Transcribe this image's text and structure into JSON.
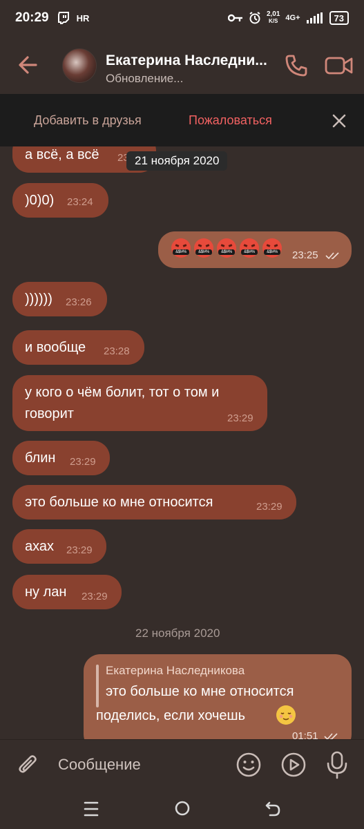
{
  "status_bar": {
    "time": "20:29",
    "carrier_badge": "HR",
    "speed_value": "2,01",
    "speed_unit": "K/S",
    "network": "4G+",
    "battery": "73"
  },
  "header": {
    "contact_name": "Екатерина Наследни...",
    "status": "Обновление..."
  },
  "actions": {
    "add_friend": "Добавить в друзья",
    "report": "Пожаловаться"
  },
  "messages": [
    {
      "dir": "in",
      "text": "а всё, а всё",
      "time": "23"
    },
    {
      "dir": "in",
      "text": ")0)0)",
      "time": "23:24"
    },
    {
      "dir": "out",
      "emoji_text": "&$!#%",
      "time": "23:25"
    },
    {
      "dir": "in",
      "text": "))))))",
      "time": "23:26"
    },
    {
      "dir": "in",
      "text": "и вообще",
      "time": "23:28"
    },
    {
      "dir": "in",
      "text_line1": "у кого о чём болит, тот о том и",
      "text_line2": "говорит",
      "time": "23:29"
    },
    {
      "dir": "in",
      "text": "блин",
      "time": "23:29"
    },
    {
      "dir": "in",
      "text": "это больше ко мне относится",
      "time": "23:29"
    },
    {
      "dir": "in",
      "text": "ахах",
      "time": "23:29"
    },
    {
      "dir": "in",
      "text": "ну лан",
      "time": "23:29"
    },
    {
      "dir": "out",
      "reply_name": "Екатерина Наследникова",
      "reply_text": "это больше ко мне относится",
      "text": "поделись, если хочешь",
      "time": "01:51"
    }
  ],
  "date_chip": "21 ноября 2020",
  "date_separator": "22 ноября 2020",
  "composer": {
    "placeholder": "Сообщение"
  },
  "icons": {
    "back": "arrow-left-icon",
    "call": "phone-icon",
    "video": "video-camera-icon",
    "close": "close-icon",
    "attach": "paperclip-icon",
    "sticker": "smiley-icon",
    "play": "play-circle-icon",
    "mic": "microphone-icon"
  },
  "colors": {
    "background": "#362d2a",
    "incoming_bubble": "#89412f",
    "outgoing_bubble": "#9b5e47",
    "accent": "#d0877a",
    "report": "#f26262"
  }
}
